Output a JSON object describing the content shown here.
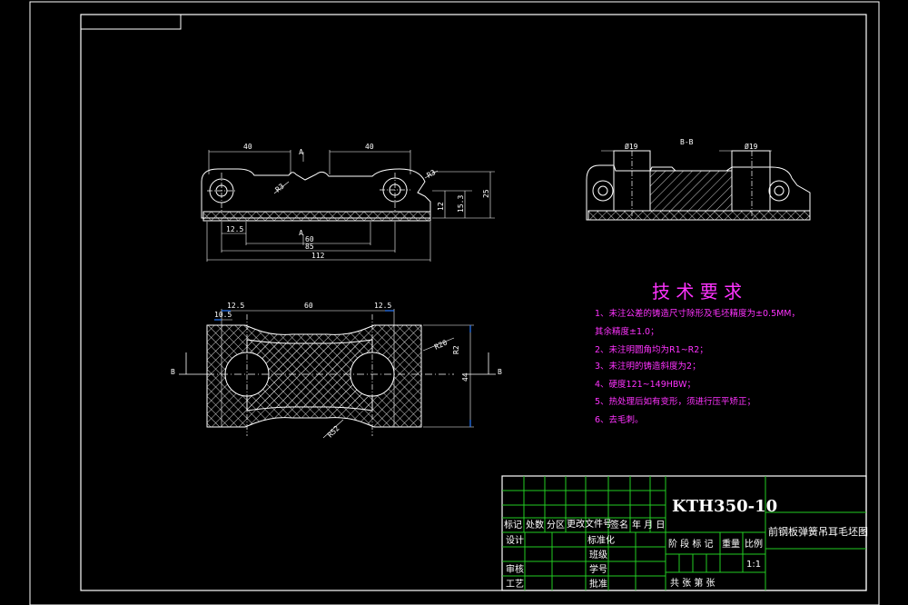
{
  "colors": {
    "background": "#000000",
    "lines": "#ffffff",
    "hatch": "#ffffff",
    "title_block": "#22cc22",
    "requirements": "#ff33ff",
    "dim_accent": "#2a7bff"
  },
  "views": {
    "front": {
      "dims": {
        "top_left": "40",
        "top_right": "40",
        "section_mark_top": "A",
        "section_mark_bottom": "A",
        "r3_left": "R3",
        "r3_right": "R3",
        "h12": "12",
        "h15_3": "15.3",
        "h25": "25",
        "w12_5": "12.5",
        "w60": "60",
        "w85": "85",
        "w112": "112"
      }
    },
    "section_bb": {
      "title": "B-B",
      "dia_left": "Ø19",
      "dia_right": "Ø19"
    },
    "plan": {
      "dims": {
        "w12_5_left": "12.5",
        "w60": "60",
        "w12_5_right": "12.5",
        "w10_5": "10.5",
        "r20": "R20",
        "r2": "R2",
        "h44": "44",
        "r_diag": "R52",
        "b_left": "B",
        "b_right": "B"
      }
    }
  },
  "requirements": {
    "title": "技 术 要 求",
    "items": [
      "1、未注公差的铸造尺寸除形及毛坯精度为±0.5MM，",
      "其余精度±1.0；",
      "2、未注明圆角均为R1~R2；",
      "3、未注明的铸造斜度为2；",
      "4、硬度121~149HBW；",
      "5、热处理后如有变形，须进行压平矫正；",
      "6、去毛刺。"
    ]
  },
  "title_block": {
    "code": "KTH350-10",
    "part_name": "前钢板弹簧吊耳毛坯图",
    "row_headers": [
      "标记",
      "处数",
      "分区",
      "更改文件号",
      "签名",
      "年 月 日"
    ],
    "left_labels": [
      "设计",
      "审核",
      "工艺"
    ],
    "mid_labels": [
      "标准化",
      "班级",
      "学号",
      "批准"
    ],
    "stage_headers": [
      "阶 段 标 记",
      "重量",
      "比例"
    ],
    "scale": "1:1",
    "sheets": "共  张  第  张"
  }
}
